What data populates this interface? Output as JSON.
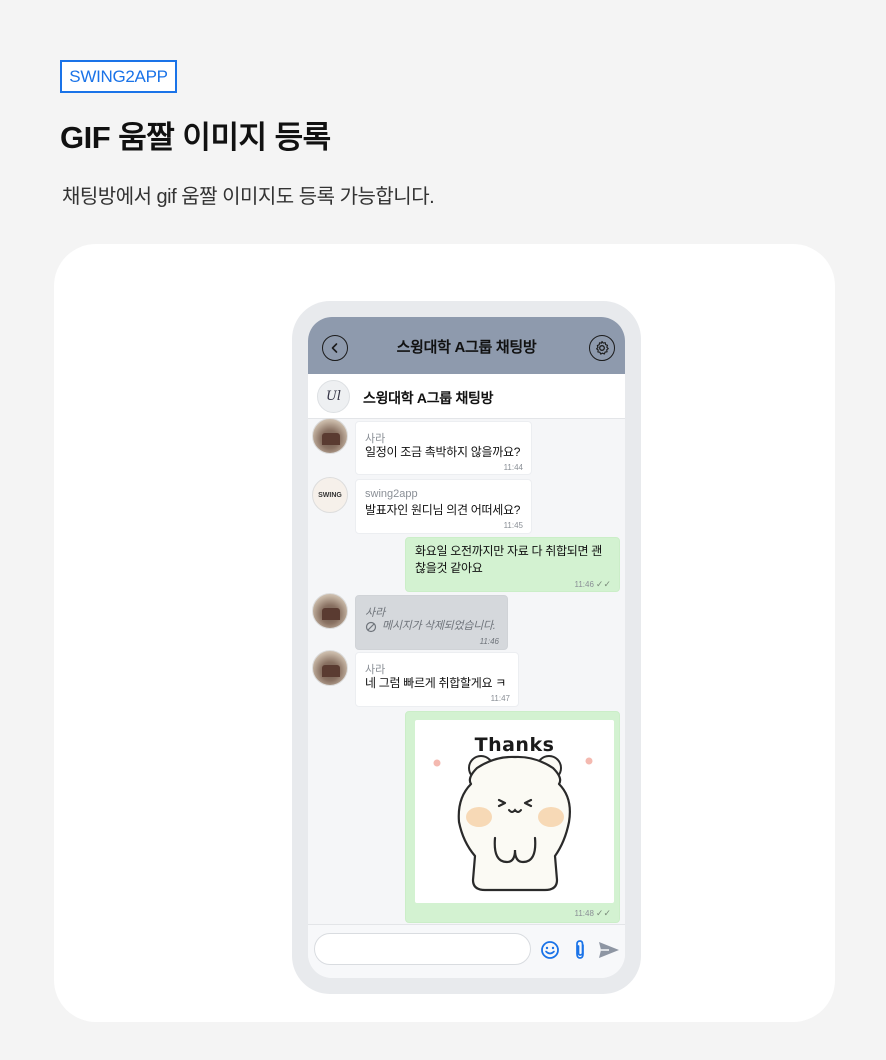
{
  "page": {
    "tag": "SWING2APP",
    "title": "GIF 움짤 이미지 등록",
    "subtitle": "채팅방에서 gif 움짤 이미지도 등록 가능합니다."
  },
  "chat": {
    "header_title": "스윙대학 A그룹 채팅방",
    "room_name": "스윙대학 A그룹 채팅방",
    "room_avatar_text": "Ul",
    "messages": [
      {
        "sender": "사라",
        "text": "일정이 조금 촉박하지 않을까요?",
        "time": "11:44"
      },
      {
        "sender": "swing2app",
        "text": "발표자인 원디님 의견 어떠세요?",
        "time": "11:45",
        "avatar_text": "SWING"
      },
      {
        "line1": "화요일 오전까지만 자료 다 취합되면 괜",
        "line2": "찮을것 같아요",
        "time": "11:46"
      },
      {
        "sender": "사라",
        "text": "메시지가 삭제되었습니다.",
        "time": "11:46"
      },
      {
        "sender": "사라",
        "text": "네 그럼 빠르게 취합할게요 ㅋ",
        "time": "11:47"
      },
      {
        "gif_text": "Thanks",
        "time": "11:48"
      }
    ],
    "input_placeholder": ""
  },
  "colors": {
    "accent": "#1a73e8",
    "appbar": "#8e9aad",
    "my_bubble": "#d3f2d1",
    "deleted_bubble": "#d5d8dc",
    "composer_icons": "#1a73e8"
  },
  "icons": [
    "back-icon",
    "gear-icon",
    "ban-icon",
    "read-check-icon",
    "emoji-icon",
    "paperclip-icon",
    "send-icon"
  ]
}
